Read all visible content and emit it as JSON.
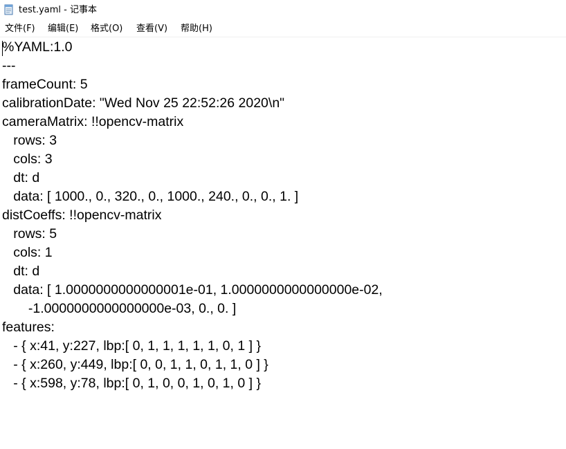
{
  "window": {
    "title": "test.yaml - 记事本",
    "icon": "notepad-icon"
  },
  "menu": [
    "文件(F)",
    "编辑(E)",
    "格式(O)",
    "查看(V)",
    "帮助(H)"
  ],
  "document": {
    "lines": [
      "%YAML:1.0",
      "---",
      "frameCount: 5",
      "calibrationDate: \"Wed Nov 25 22:52:26 2020\\n\"",
      "cameraMatrix: !!opencv-matrix",
      "   rows: 3",
      "   cols: 3",
      "   dt: d",
      "   data: [ 1000., 0., 320., 0., 1000., 240., 0., 0., 1. ]",
      "distCoeffs: !!opencv-matrix",
      "   rows: 5",
      "   cols: 1",
      "   dt: d",
      "   data: [ 1.0000000000000001e-01, 1.0000000000000000e-02,",
      "       -1.0000000000000000e-03, 0., 0. ]",
      "features:",
      "   - { x:41, y:227, lbp:[ 0, 1, 1, 1, 1, 1, 0, 1 ] }",
      "   - { x:260, y:449, lbp:[ 0, 0, 1, 1, 0, 1, 1, 0 ] }",
      "   - { x:598, y:78, lbp:[ 0, 1, 0, 0, 1, 0, 1, 0 ] }"
    ]
  }
}
